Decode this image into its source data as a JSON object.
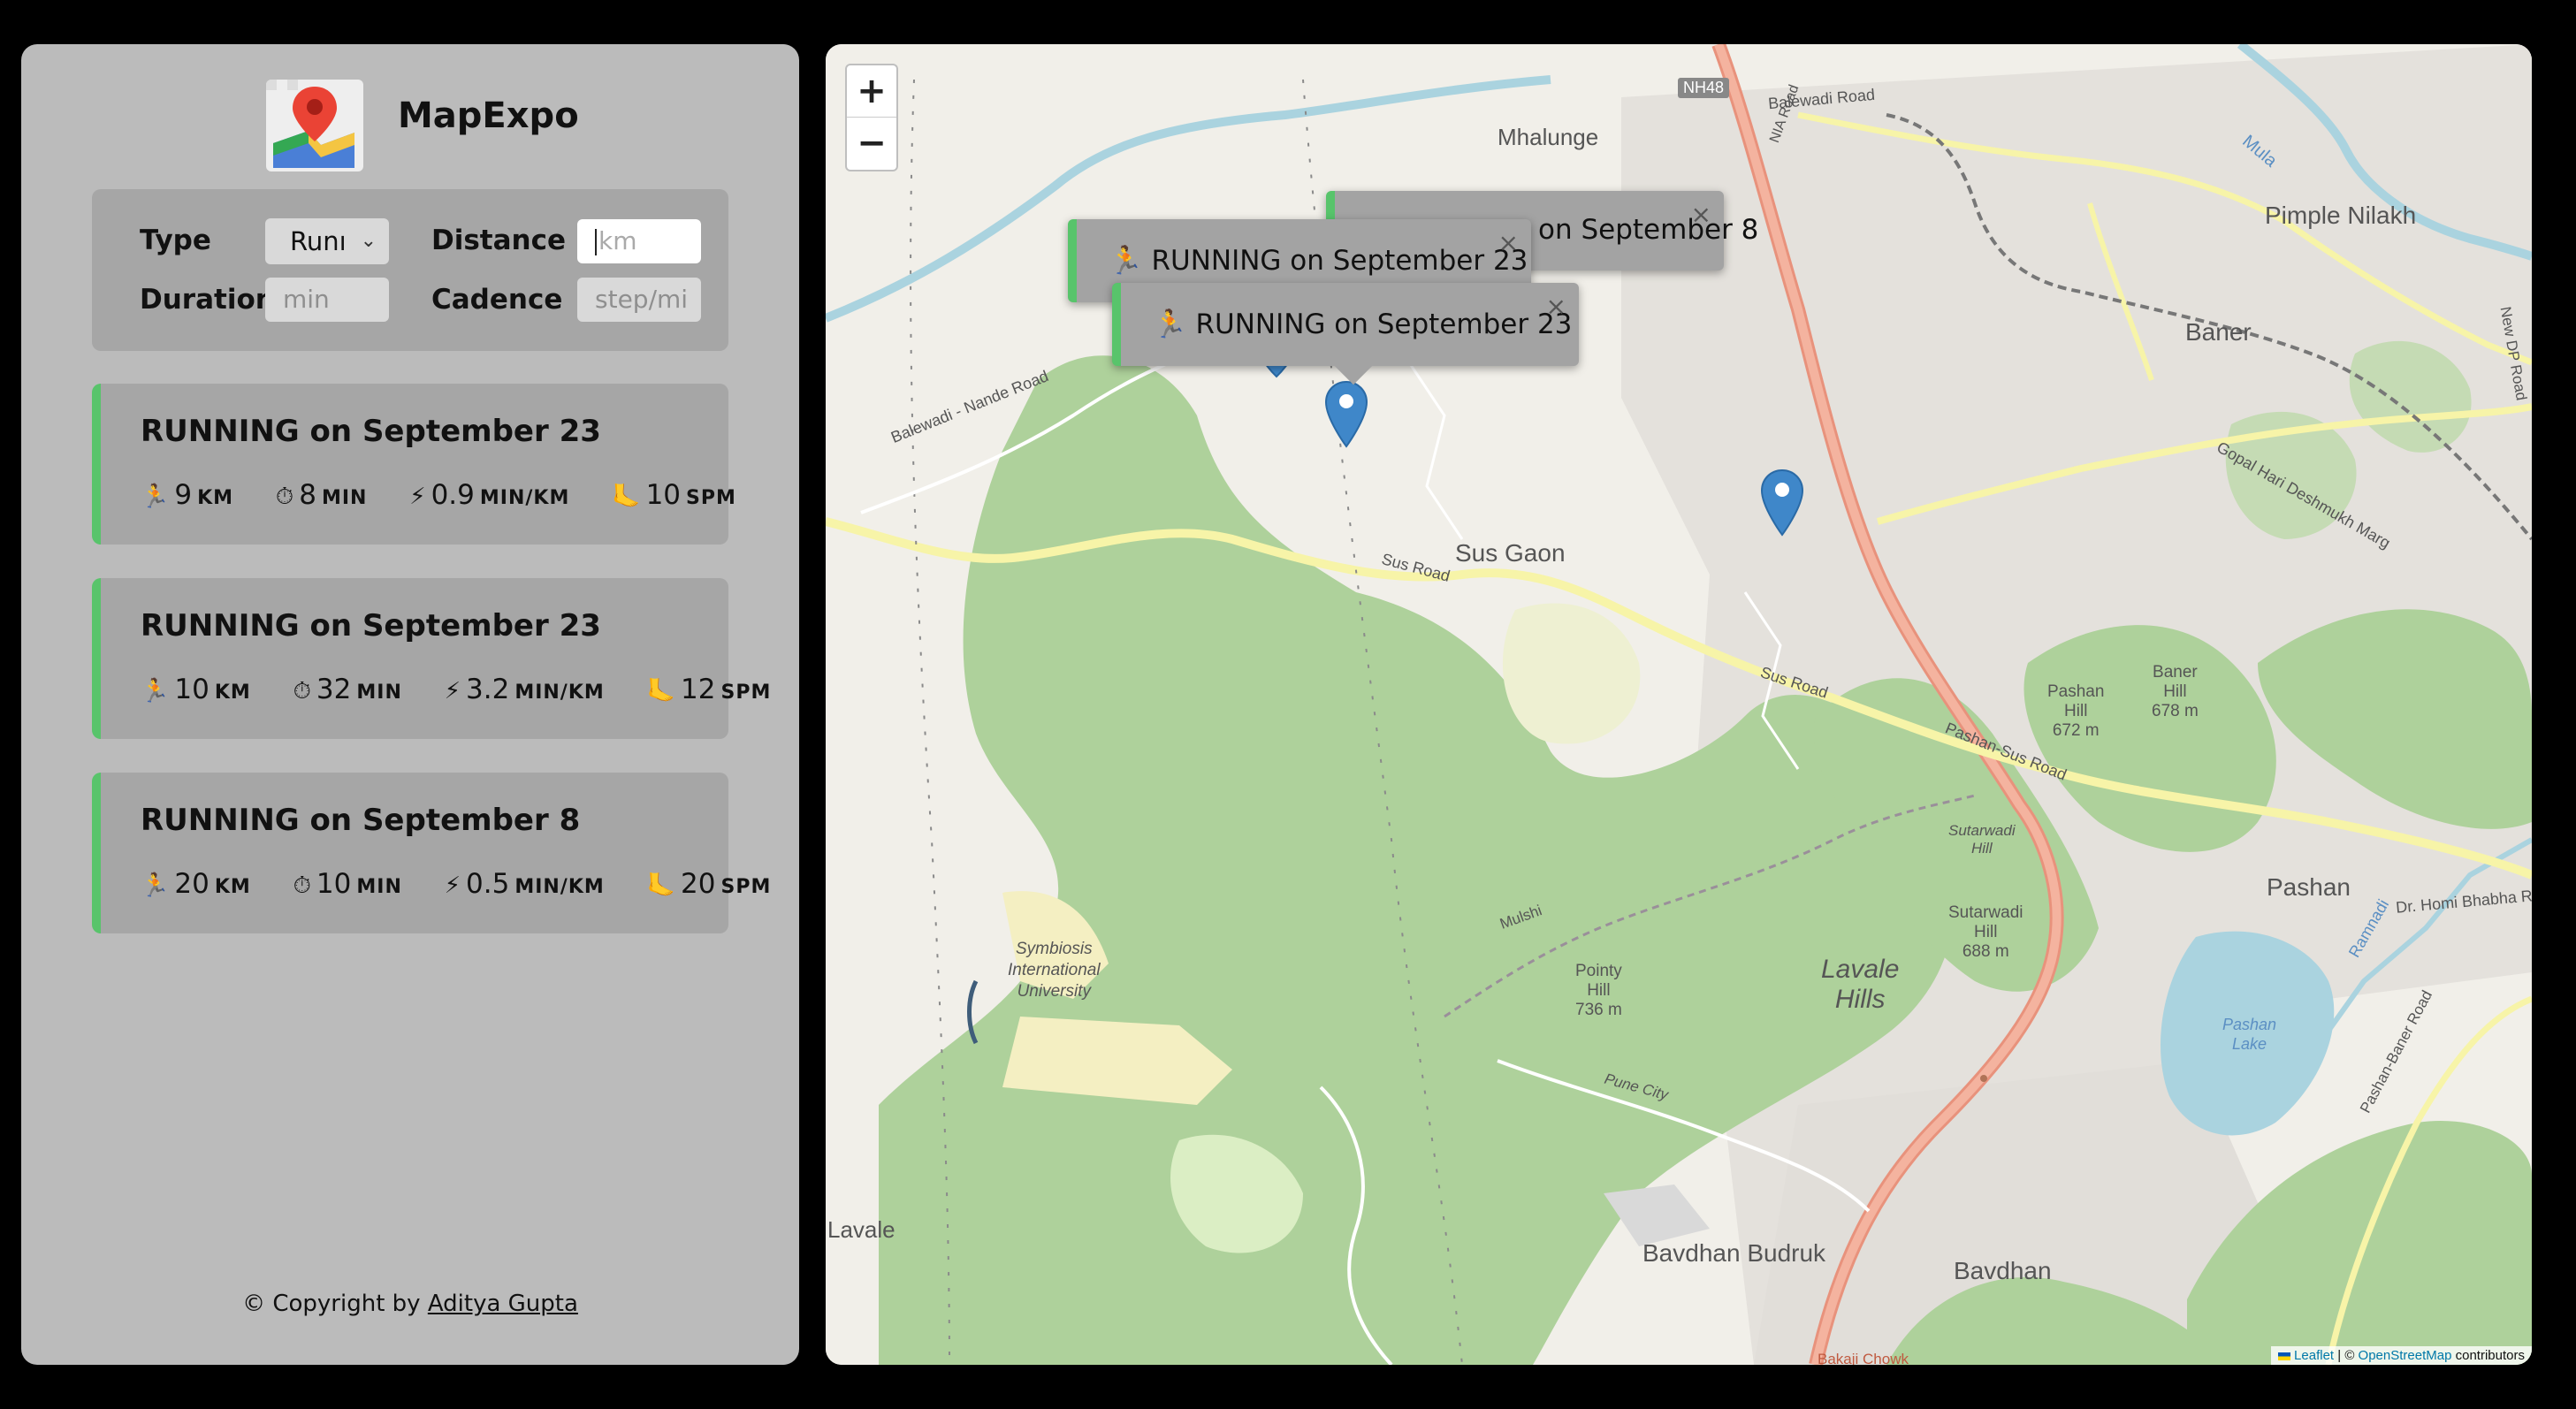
{
  "app": {
    "title": "MapExpo"
  },
  "form": {
    "type_label": "Type",
    "type_value": "Runı",
    "distance_label": "Distance",
    "distance_placeholder": "km",
    "duration_label": "Duration",
    "duration_placeholder": "min",
    "cadence_label": "Cadence",
    "cadence_placeholder": "step/mi"
  },
  "workouts": [
    {
      "title": "RUNNING on September 23",
      "distance": "9",
      "distance_unit": "KM",
      "duration": "8",
      "duration_unit": "MIN",
      "pace": "0.9",
      "pace_unit": "MIN/KM",
      "cadence": "10",
      "cadence_unit": "SPM"
    },
    {
      "title": "RUNNING on September 23",
      "distance": "10",
      "distance_unit": "KM",
      "duration": "32",
      "duration_unit": "MIN",
      "pace": "3.2",
      "pace_unit": "MIN/KM",
      "cadence": "12",
      "cadence_unit": "SPM"
    },
    {
      "title": "RUNNING on September 8",
      "distance": "20",
      "distance_unit": "KM",
      "duration": "10",
      "duration_unit": "MIN",
      "pace": "0.5",
      "pace_unit": "MIN/KM",
      "cadence": "20",
      "cadence_unit": "SPM"
    }
  ],
  "icons": {
    "runner": "🏃",
    "stopwatch": "⏱",
    "bolt": "⚡",
    "foot": "🦶"
  },
  "footer": {
    "prefix": "© Copyright by ",
    "author": "Aditya Gupta"
  },
  "map": {
    "zoom_in": "+",
    "zoom_out": "−",
    "popups": [
      {
        "text": "on September 8",
        "close": "×"
      },
      {
        "text": "RUNNING on September 23",
        "close": "×"
      },
      {
        "text": "RUNNING on September 23",
        "close": "×"
      }
    ],
    "labels": {
      "mhalunge": "Mhalunge",
      "nh48": "NH48",
      "pimple": "Pimple Nilakh",
      "baner": "Baner",
      "sus_gaon": "Sus Gaon",
      "sus_road": "Sus Road",
      "sus_road2": "Sus Road",
      "pashan_sus": "Pashan-Sus Road",
      "balewadi_nande": "Balewadi - Nande Road",
      "balewadi_road": "Balewadi Road",
      "pashan_hill": "Pashan",
      "pashan_hill2": "Hill",
      "pashan_hill_h": "672 m",
      "baner_hill": "Baner",
      "baner_hill2": "Hill",
      "baner_hill_h": "678 m",
      "sutarwadi_hill": "Sutarwadi",
      "sutarwadi_hill2": "Hill",
      "sutarwadi_hill_b": "Sutarwadi",
      "sutarwadi_hill_b2": "Hill",
      "sutarwadi_hill_h": "688 m",
      "pashan": "Pashan",
      "homi": "Dr. Homi Bhabha R",
      "pashan_lake": "Pashan",
      "pashan_lake2": "Lake",
      "pashan_baner": "Pashan-Baner Road",
      "lavale_hills": "Lavale",
      "lavale_hills2": "Hills",
      "pointy": "Pointy",
      "pointy2": "Hill",
      "pointy_h": "736 m",
      "symbiosis": "Symbiosis",
      "symbiosis2": "International",
      "symbiosis3": "University",
      "mulshi": "Mulshi",
      "pune_city": "Pune City",
      "lavale": "Lavale",
      "bavdhan_budruk": "Bavdhan Budruk",
      "bavdhan": "Bavdhan",
      "bakaji": "Bakaji Chowk",
      "gopal": "Gopal Hari Deshmukh Marg",
      "new_dp": "New DP Road",
      "mula": "Mula",
      "ramnadi": "Ramnadi",
      "nia": "NIA Road"
    },
    "attribution": {
      "leaflet": "Leaflet",
      "sep": " | © ",
      "osm": "OpenStreetMap",
      "suffix": " contributors"
    }
  },
  "colors": {
    "accent_green": "#58c46b",
    "marker_blue": "#3f87c9",
    "forest": "#aed19b"
  }
}
